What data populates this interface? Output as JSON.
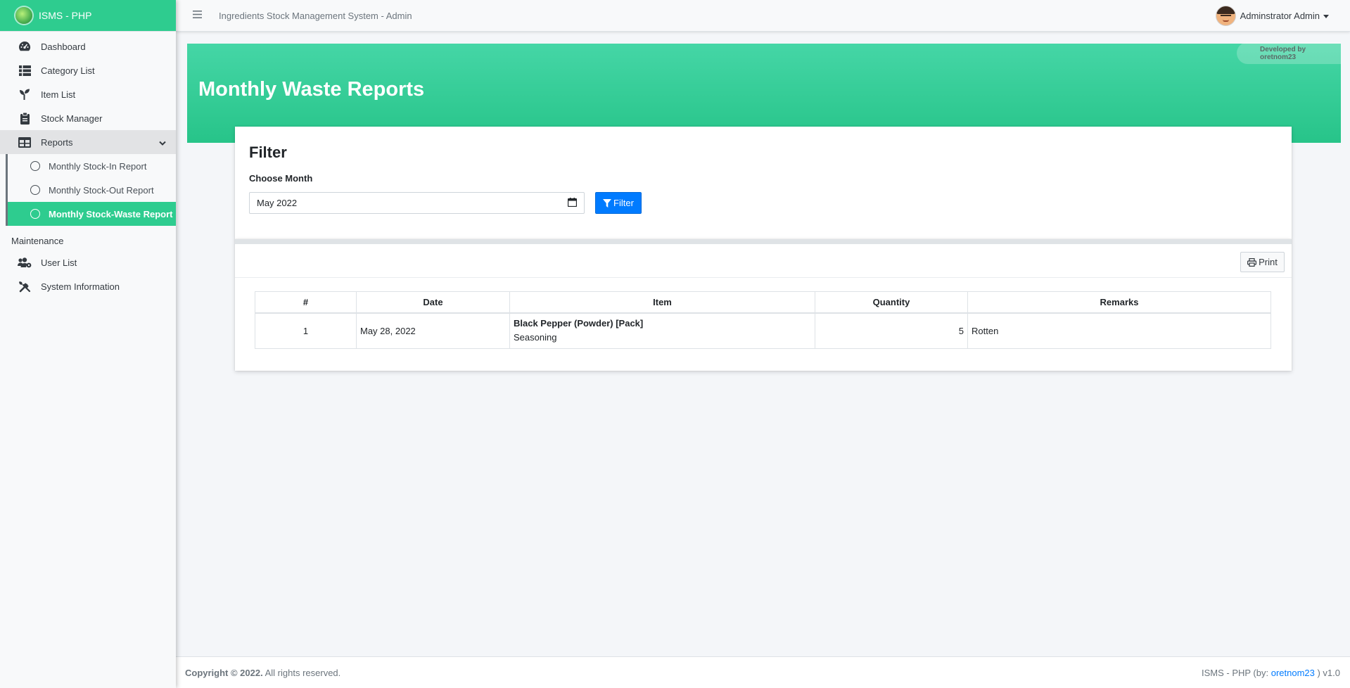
{
  "brand": {
    "name": "ISMS - PHP"
  },
  "sidebar": {
    "items": [
      {
        "label": "Dashboard",
        "icon": "tachometer-icon"
      },
      {
        "label": "Category List",
        "icon": "list-icon"
      },
      {
        "label": "Item List",
        "icon": "seedling-icon"
      },
      {
        "label": "Stock Manager",
        "icon": "clipboard-icon"
      },
      {
        "label": "Reports",
        "icon": "table-icon"
      }
    ],
    "reports_submenu": [
      {
        "label": "Monthly Stock-In Report"
      },
      {
        "label": "Monthly Stock-Out Report"
      },
      {
        "label": "Monthly Stock-Waste Report",
        "active": true
      }
    ],
    "maintenance_header": "Maintenance",
    "maintenance_items": [
      {
        "label": "User List",
        "icon": "users-cog-icon"
      },
      {
        "label": "System Information",
        "icon": "tools-icon"
      }
    ]
  },
  "topbar": {
    "system_title": "Ingredients Stock Management System - Admin",
    "user_name": "Adminstrator Admin"
  },
  "header": {
    "page_title": "Monthly Waste Reports",
    "developer_badge": "Developed by oretnom23"
  },
  "filter": {
    "title": "Filter",
    "label": "Choose Month",
    "month_value": "May 2022",
    "button_label": "Filter"
  },
  "report": {
    "print_label": "Print",
    "columns": [
      "#",
      "Date",
      "Item",
      "Quantity",
      "Remarks"
    ],
    "rows": [
      {
        "num": "1",
        "date": "May 28, 2022",
        "item": "Black Pepper (Powder) [Pack]",
        "category": "Seasoning",
        "quantity": "5",
        "remarks": "Rotten"
      }
    ]
  },
  "footer": {
    "copyright": "Copyright © 2022.",
    "rights": " All rights reserved.",
    "right_prefix": "ISMS - PHP (by: ",
    "right_link": "oretnom23",
    "right_suffix": " ) v1.0"
  },
  "colors": {
    "accent": "#2ecc8f",
    "primary": "#007bff",
    "sidebar_bg": "#f8f9fa",
    "content_bg": "#f4f6f9"
  }
}
